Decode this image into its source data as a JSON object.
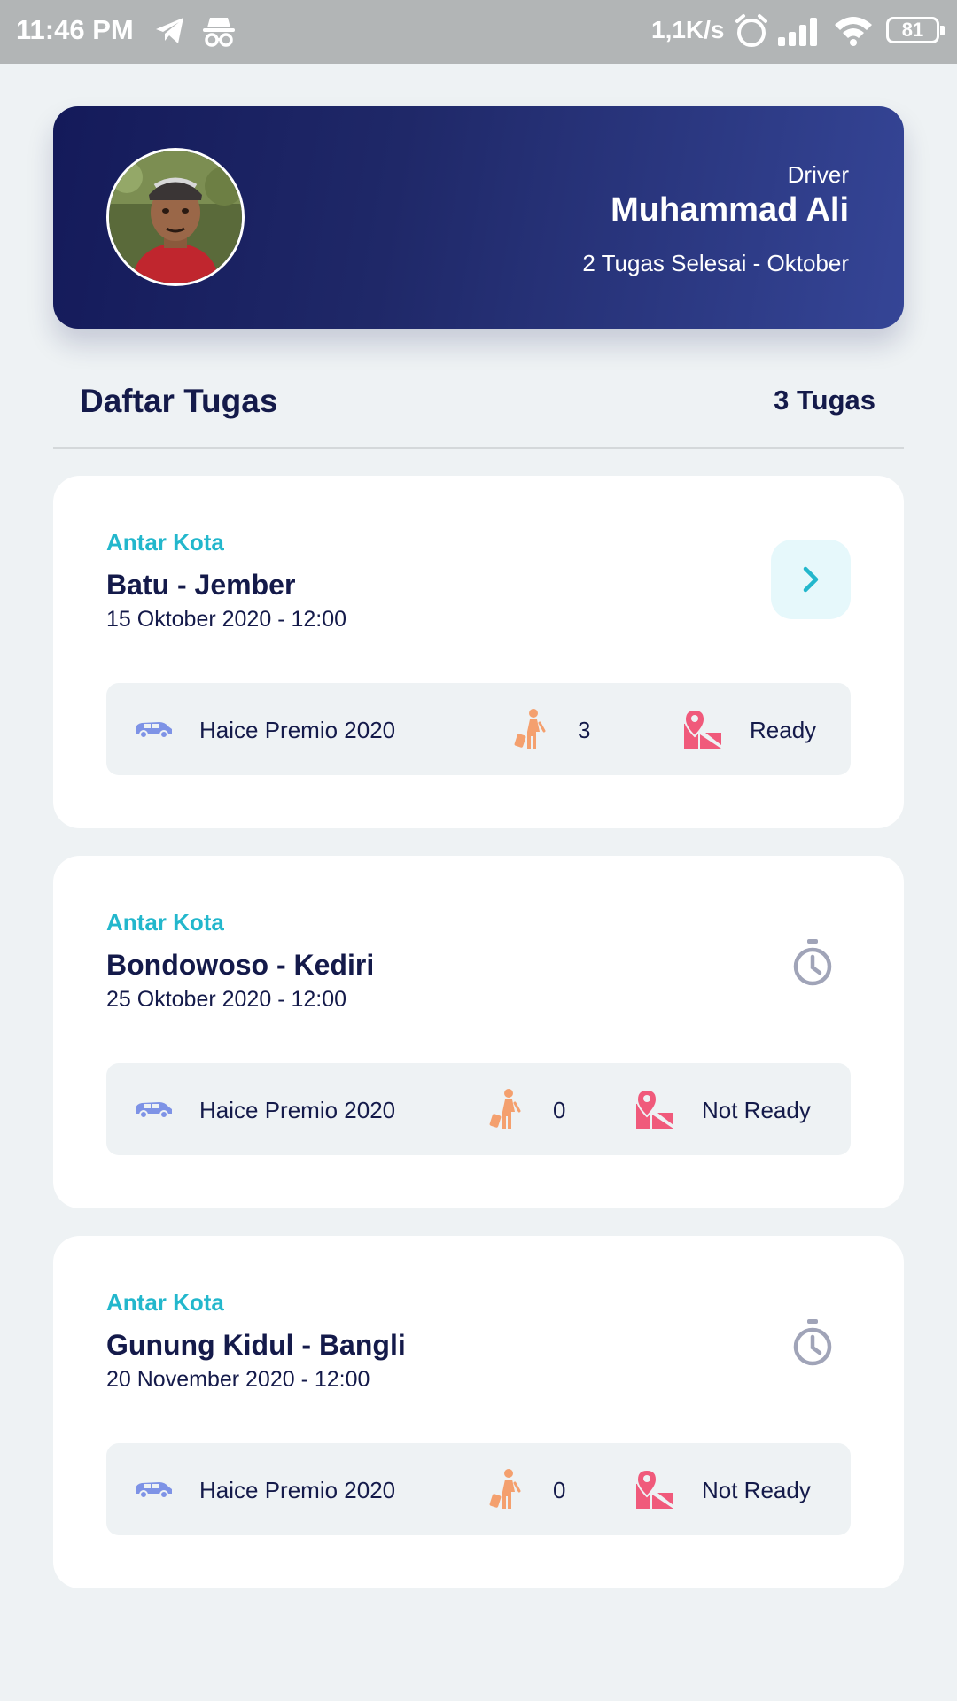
{
  "status_bar": {
    "time": "11:46 PM",
    "network_speed": "1,1K/s",
    "battery": "81"
  },
  "profile": {
    "role": "Driver",
    "name": "Muhammad Ali",
    "summary": "2 Tugas Selesai - Oktober"
  },
  "tasks_header": {
    "title": "Daftar Tugas",
    "count": "3 Tugas"
  },
  "tasks": [
    {
      "type": "Antar Kota",
      "route": "Batu - Jember",
      "datetime": "15 Oktober 2020 - 12:00",
      "vehicle": "Haice Premio 2020",
      "passengers": "3",
      "status": "Ready",
      "action_icon": "chevron-right-icon"
    },
    {
      "type": "Antar Kota",
      "route": "Bondowoso - Kediri",
      "datetime": "25 Oktober 2020 - 12:00",
      "vehicle": "Haice Premio 2020",
      "passengers": "0",
      "status": "Not Ready",
      "action_icon": "timer-icon"
    },
    {
      "type": "Antar Kota",
      "route": "Gunung Kidul - Bangli",
      "datetime": "20 November 2020 - 12:00",
      "vehicle": "Haice Premio 2020",
      "passengers": "0",
      "status": "Not Ready",
      "action_icon": "timer-icon"
    }
  ],
  "colors": {
    "accent": "#23b7cc",
    "primary_dark": "#141a5a",
    "car_icon": "#7e93e6",
    "passenger_icon": "#f4a06e",
    "map_icon": "#f05a7b",
    "timer_icon": "#a0a4b8"
  }
}
